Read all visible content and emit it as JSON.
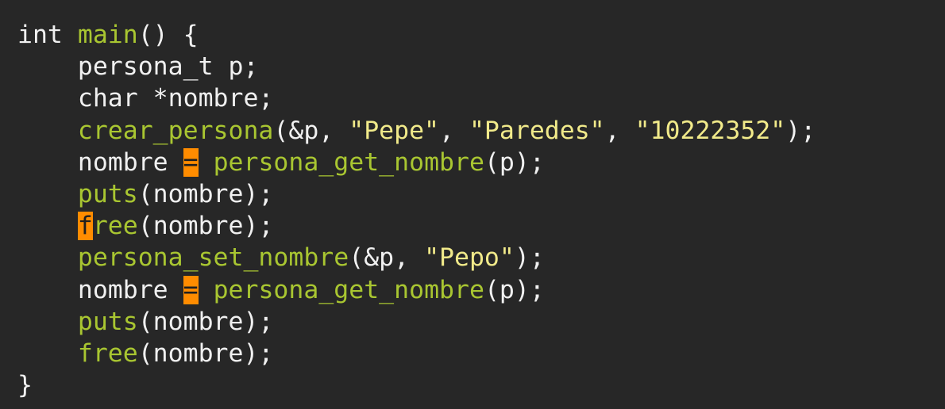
{
  "editor": {
    "colors": {
      "background": "#272727",
      "plain": "#f0f0f0",
      "function": "#a9c631",
      "string": "#f1ea8a",
      "highlight": "#ff8c00"
    },
    "lines": [
      [
        {
          "t": "int ",
          "k": "plain"
        },
        {
          "t": "main",
          "k": "fn"
        },
        {
          "t": "() {",
          "k": "plain"
        }
      ],
      [
        {
          "t": "    persona_t p;",
          "k": "plain"
        }
      ],
      [
        {
          "t": "    char *nombre;",
          "k": "plain"
        }
      ],
      [
        {
          "t": "    ",
          "k": "plain"
        },
        {
          "t": "crear_persona",
          "k": "fn"
        },
        {
          "t": "(&p, ",
          "k": "plain"
        },
        {
          "t": "\"Pepe\"",
          "k": "str"
        },
        {
          "t": ", ",
          "k": "plain"
        },
        {
          "t": "\"Paredes\"",
          "k": "str"
        },
        {
          "t": ", ",
          "k": "plain"
        },
        {
          "t": "\"10222352\"",
          "k": "str"
        },
        {
          "t": ");",
          "k": "plain"
        }
      ],
      [
        {
          "t": "    nombre ",
          "k": "plain"
        },
        {
          "t": "=",
          "k": "cursor-eq"
        },
        {
          "t": " ",
          "k": "plain"
        },
        {
          "t": "persona_get_nombre",
          "k": "fn"
        },
        {
          "t": "(p);",
          "k": "plain"
        }
      ],
      [
        {
          "t": "    ",
          "k": "plain"
        },
        {
          "t": "puts",
          "k": "fn"
        },
        {
          "t": "(nombre);",
          "k": "plain"
        }
      ],
      [
        {
          "t": "    ",
          "k": "plain"
        },
        {
          "t": "f",
          "k": "cursor-f"
        },
        {
          "t": "ree",
          "k": "fn"
        },
        {
          "t": "(nombre);",
          "k": "plain"
        }
      ],
      [
        {
          "t": "    ",
          "k": "plain"
        },
        {
          "t": "persona_set_nombre",
          "k": "fn"
        },
        {
          "t": "(&p, ",
          "k": "plain"
        },
        {
          "t": "\"Pepo\"",
          "k": "str"
        },
        {
          "t": ");",
          "k": "plain"
        }
      ],
      [
        {
          "t": "    nombre ",
          "k": "plain"
        },
        {
          "t": "=",
          "k": "cursor-eq"
        },
        {
          "t": " ",
          "k": "plain"
        },
        {
          "t": "persona_get_nombre",
          "k": "fn"
        },
        {
          "t": "(p);",
          "k": "plain"
        }
      ],
      [
        {
          "t": "    ",
          "k": "plain"
        },
        {
          "t": "puts",
          "k": "fn"
        },
        {
          "t": "(nombre);",
          "k": "plain"
        }
      ],
      [
        {
          "t": "    ",
          "k": "plain"
        },
        {
          "t": "free",
          "k": "fn"
        },
        {
          "t": "(nombre);",
          "k": "plain"
        }
      ],
      [
        {
          "t": "}",
          "k": "plain"
        }
      ]
    ]
  }
}
